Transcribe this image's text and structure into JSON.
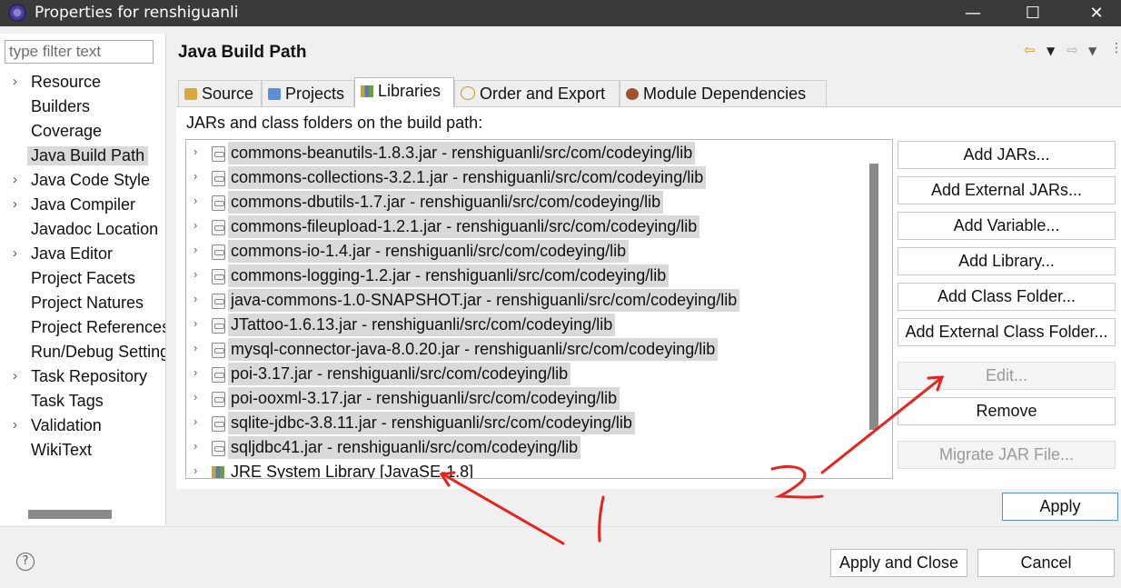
{
  "window": {
    "title": "Properties for renshiguanli",
    "minimize": "—",
    "maximize": "☐",
    "close": "✕"
  },
  "sidebar": {
    "filter_placeholder": "type filter text",
    "items": [
      {
        "label": "Resource",
        "expandable": true
      },
      {
        "label": "Builders",
        "expandable": false
      },
      {
        "label": "Coverage",
        "expandable": false
      },
      {
        "label": "Java Build Path",
        "expandable": false,
        "selected": true
      },
      {
        "label": "Java Code Style",
        "expandable": true
      },
      {
        "label": "Java Compiler",
        "expandable": true
      },
      {
        "label": "Javadoc Location",
        "expandable": false
      },
      {
        "label": "Java Editor",
        "expandable": true
      },
      {
        "label": "Project Facets",
        "expandable": false
      },
      {
        "label": "Project Natures",
        "expandable": false
      },
      {
        "label": "Project References",
        "expandable": false
      },
      {
        "label": "Run/Debug Settings",
        "expandable": false
      },
      {
        "label": "Task Repository",
        "expandable": true
      },
      {
        "label": "Task Tags",
        "expandable": false
      },
      {
        "label": "Validation",
        "expandable": true
      },
      {
        "label": "WikiText",
        "expandable": false
      }
    ]
  },
  "main": {
    "title": "Java Build Path",
    "tabs": [
      "Source",
      "Projects",
      "Libraries",
      "Order and Export",
      "Module Dependencies"
    ],
    "active_tab": "Libraries",
    "list_label": "JARs and class folders on the build path:",
    "entries": [
      "commons-beanutils-1.8.3.jar - renshiguanli/src/com/codeying/lib",
      "commons-collections-3.2.1.jar - renshiguanli/src/com/codeying/lib",
      "commons-dbutils-1.7.jar - renshiguanli/src/com/codeying/lib",
      "commons-fileupload-1.2.1.jar - renshiguanli/src/com/codeying/lib",
      "commons-io-1.4.jar - renshiguanli/src/com/codeying/lib",
      "commons-logging-1.2.jar - renshiguanli/src/com/codeying/lib",
      "java-commons-1.0-SNAPSHOT.jar - renshiguanli/src/com/codeying/lib",
      "JTattoo-1.6.13.jar - renshiguanli/src/com/codeying/lib",
      "mysql-connector-java-8.0.20.jar - renshiguanli/src/com/codeying/lib",
      "poi-3.17.jar - renshiguanli/src/com/codeying/lib",
      "poi-ooxml-3.17.jar - renshiguanli/src/com/codeying/lib",
      "sqlite-jdbc-3.8.11.jar - renshiguanli/src/com/codeying/lib",
      "sqljdbc41.jar - renshiguanli/src/com/codeying/lib"
    ],
    "jre_entry": "JRE System Library [JavaSE-1.8]",
    "buttons": {
      "add_jars": "Add JARs...",
      "add_external_jars": "Add External JARs...",
      "add_variable": "Add Variable...",
      "add_library": "Add Library...",
      "add_class_folder": "Add Class Folder...",
      "add_external_class_folder": "Add External Class Folder...",
      "edit": "Edit...",
      "remove": "Remove",
      "migrate_jar": "Migrate JAR File..."
    },
    "apply": "Apply"
  },
  "footer": {
    "help": "?",
    "apply_and_close": "Apply and Close",
    "cancel": "Cancel"
  },
  "annotations": {
    "color": "#e8231e",
    "label_1": "1",
    "label_2": "2"
  }
}
